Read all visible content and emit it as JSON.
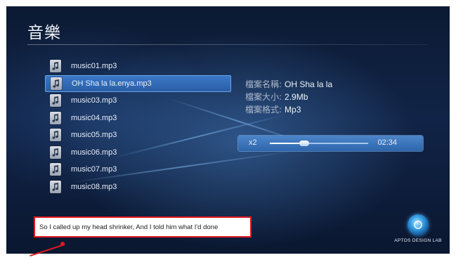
{
  "header": {
    "title": "音樂"
  },
  "playlist": {
    "items": [
      {
        "label": "music01.mp3",
        "icon": "music-file-icon",
        "selected": false
      },
      {
        "label": "OH Sha la la.enya.mp3",
        "icon": "music-file-icon",
        "selected": true
      },
      {
        "label": "music03.mp3",
        "icon": "music-file-icon",
        "selected": false
      },
      {
        "label": "music04.mp3",
        "icon": "music-file-icon",
        "selected": false
      },
      {
        "label": "music05.mp3",
        "icon": "music-file-icon",
        "selected": false
      },
      {
        "label": "music06.mp3",
        "icon": "music-file-icon",
        "selected": false
      },
      {
        "label": "music07.mp3",
        "icon": "music-file-icon",
        "selected": false
      },
      {
        "label": "music08.mp3",
        "icon": "music-file-icon",
        "selected": false
      }
    ]
  },
  "details": {
    "name_key": "檔案名稱:",
    "name_value": "OH Sha la la",
    "size_key": "檔案大小:",
    "size_value": "2.9Mb",
    "format_key": "檔案格式:",
    "format_value": "Mp3"
  },
  "player": {
    "speed": "x2",
    "time": "02:34",
    "progress": 0.35
  },
  "lyrics": {
    "text": "So I called up my head shrinker, And I told him what I'd done"
  },
  "branding": {
    "logo_text": "APTOS DESIGN LAB"
  },
  "colors": {
    "accent": "#3a78c9",
    "highlight_border": "#e0191f",
    "background": "#112447"
  }
}
